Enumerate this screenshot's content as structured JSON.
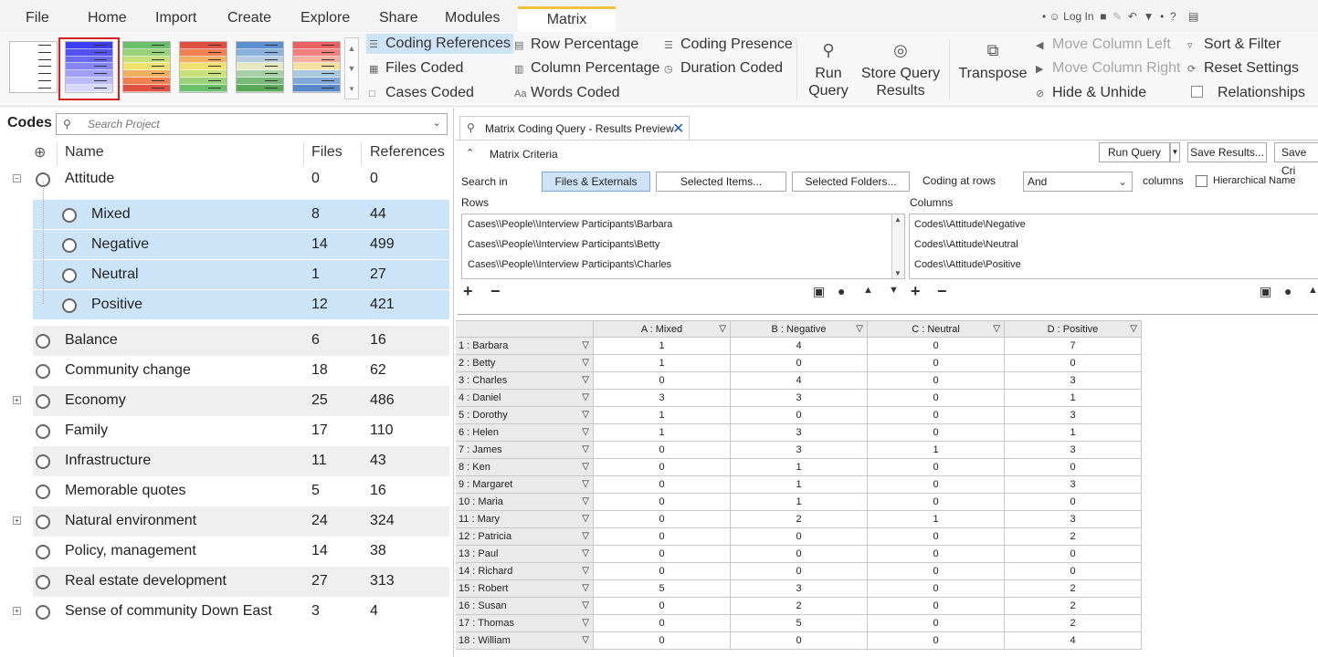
{
  "menu": {
    "file": "File",
    "tabs": [
      "Home",
      "Import",
      "Create",
      "Explore",
      "Share",
      "Modules"
    ],
    "active_tab": "Matrix",
    "login": "Log In"
  },
  "ribbon": {
    "coding_references": "Coding References",
    "files_coded": "Files Coded",
    "cases_coded": "Cases Coded",
    "row_percentage": "Row Percentage",
    "column_percentage": "Column Percentage",
    "words_coded": "Words Coded",
    "coding_presence": "Coding Presence",
    "duration_coded": "Duration Coded",
    "run_query": [
      "Run",
      "Query"
    ],
    "store_results": [
      "Store Query",
      "Results"
    ],
    "transpose": "Transpose",
    "move_left": "Move Column Left",
    "move_right": "Move Column Right",
    "hide_unhide": "Hide & Unhide",
    "sort_filter": "Sort & Filter",
    "reset_settings": "Reset Settings",
    "relationships": "Relationships"
  },
  "swatches": [
    [
      "#ffffff",
      "#ffffff",
      "#ffffff",
      "#ffffff",
      "#ffffff",
      "#ffffff",
      "#ffffff"
    ],
    [
      "#3c3cf0",
      "#5252f2",
      "#6a6af4",
      "#8585f6",
      "#a0a0f8",
      "#bcbcfa",
      "#d8d8fc"
    ],
    [
      "#6abf6a",
      "#9ad27a",
      "#c8e07a",
      "#f0e070",
      "#f0b060",
      "#f08050",
      "#e05040"
    ],
    [
      "#e05040",
      "#f08050",
      "#f0b060",
      "#f0e070",
      "#c8e07a",
      "#9ad27a",
      "#6abf6a"
    ],
    [
      "#5b8fd0",
      "#8ab0dc",
      "#b8cde0",
      "#e8e8c0",
      "#a8d0a8",
      "#78b878",
      "#58a858"
    ],
    [
      "#e86060",
      "#f08080",
      "#f4b0a0",
      "#f4e0a0",
      "#a8c8e0",
      "#80a8d8",
      "#5888c8"
    ]
  ],
  "codes": {
    "title": "Codes",
    "search_placeholder": "Search Project",
    "columns": [
      "Name",
      "Files",
      "References"
    ],
    "rows": [
      {
        "name": "Attitude",
        "files": "0",
        "refs": "0"
      },
      {
        "name": "Mixed",
        "files": "8",
        "refs": "44"
      },
      {
        "name": "Negative",
        "files": "14",
        "refs": "499"
      },
      {
        "name": "Neutral",
        "files": "1",
        "refs": "27"
      },
      {
        "name": "Positive",
        "files": "12",
        "refs": "421"
      },
      {
        "name": "Balance",
        "files": "6",
        "refs": "16"
      },
      {
        "name": "Community change",
        "files": "18",
        "refs": "62"
      },
      {
        "name": "Economy",
        "files": "25",
        "refs": "486"
      },
      {
        "name": "Family",
        "files": "17",
        "refs": "110"
      },
      {
        "name": "Infrastructure",
        "files": "11",
        "refs": "43"
      },
      {
        "name": "Memorable quotes",
        "files": "5",
        "refs": "16"
      },
      {
        "name": "Natural environment",
        "files": "24",
        "refs": "324"
      },
      {
        "name": "Policy, management",
        "files": "14",
        "refs": "38"
      },
      {
        "name": "Real estate development",
        "files": "27",
        "refs": "313"
      },
      {
        "name": "Sense of community Down East",
        "files": "3",
        "refs": "4"
      }
    ]
  },
  "query": {
    "tab_title": "Matrix Coding Query - Results Preview",
    "criteria": "Matrix Criteria",
    "run_query": "Run Query",
    "save_results": "Save Results...",
    "save_criteria": "Save Cri",
    "search_in": "Search in",
    "files_externals": "Files & Externals",
    "selected_items": "Selected Items...",
    "selected_folders": "Selected Folders...",
    "coding_at_rows": "Coding at rows",
    "operator": "And",
    "columns_label": "columns",
    "hierarchical": "Hierarchical Name",
    "rows_label": "Rows",
    "cols_label": "Columns",
    "row_items": [
      "Cases\\\\People\\\\Interview Participants\\Barbara",
      "Cases\\\\People\\\\Interview Participants\\Betty",
      "Cases\\\\People\\\\Interview Participants\\Charles"
    ],
    "col_items": [
      "Codes\\\\Attitude\\Negative",
      "Codes\\\\Attitude\\Neutral",
      "Codes\\\\Attitude\\Positive"
    ]
  },
  "matrix": {
    "columns": [
      "A : Mixed",
      "B : Negative",
      "C : Neutral",
      "D : Positive"
    ],
    "rows": [
      {
        "label": "1 : Barbara",
        "values": [
          "1",
          "4",
          "0",
          "7"
        ]
      },
      {
        "label": "2 : Betty",
        "values": [
          "1",
          "0",
          "0",
          "0"
        ]
      },
      {
        "label": "3 : Charles",
        "values": [
          "0",
          "4",
          "0",
          "3"
        ]
      },
      {
        "label": "4 : Daniel",
        "values": [
          "3",
          "3",
          "0",
          "1"
        ]
      },
      {
        "label": "5 : Dorothy",
        "values": [
          "1",
          "0",
          "0",
          "3"
        ]
      },
      {
        "label": "6 : Helen",
        "values": [
          "1",
          "3",
          "0",
          "1"
        ]
      },
      {
        "label": "7 : James",
        "values": [
          "0",
          "3",
          "1",
          "3"
        ]
      },
      {
        "label": "8 : Ken",
        "values": [
          "0",
          "1",
          "0",
          "0"
        ]
      },
      {
        "label": "9 : Margaret",
        "values": [
          "0",
          "1",
          "0",
          "3"
        ]
      },
      {
        "label": "10 : Maria",
        "values": [
          "0",
          "1",
          "0",
          "0"
        ]
      },
      {
        "label": "11 : Mary",
        "values": [
          "0",
          "2",
          "1",
          "3"
        ]
      },
      {
        "label": "12 : Patricia",
        "values": [
          "0",
          "0",
          "0",
          "2"
        ]
      },
      {
        "label": "13 : Paul",
        "values": [
          "0",
          "0",
          "0",
          "0"
        ]
      },
      {
        "label": "14 : Richard",
        "values": [
          "0",
          "0",
          "0",
          "0"
        ]
      },
      {
        "label": "15 : Robert",
        "values": [
          "5",
          "3",
          "0",
          "2"
        ]
      },
      {
        "label": "16 : Susan",
        "values": [
          "0",
          "2",
          "0",
          "2"
        ]
      },
      {
        "label": "17 : Thomas",
        "values": [
          "0",
          "5",
          "0",
          "2"
        ]
      },
      {
        "label": "18 : William",
        "values": [
          "0",
          "0",
          "0",
          "4"
        ]
      }
    ]
  }
}
